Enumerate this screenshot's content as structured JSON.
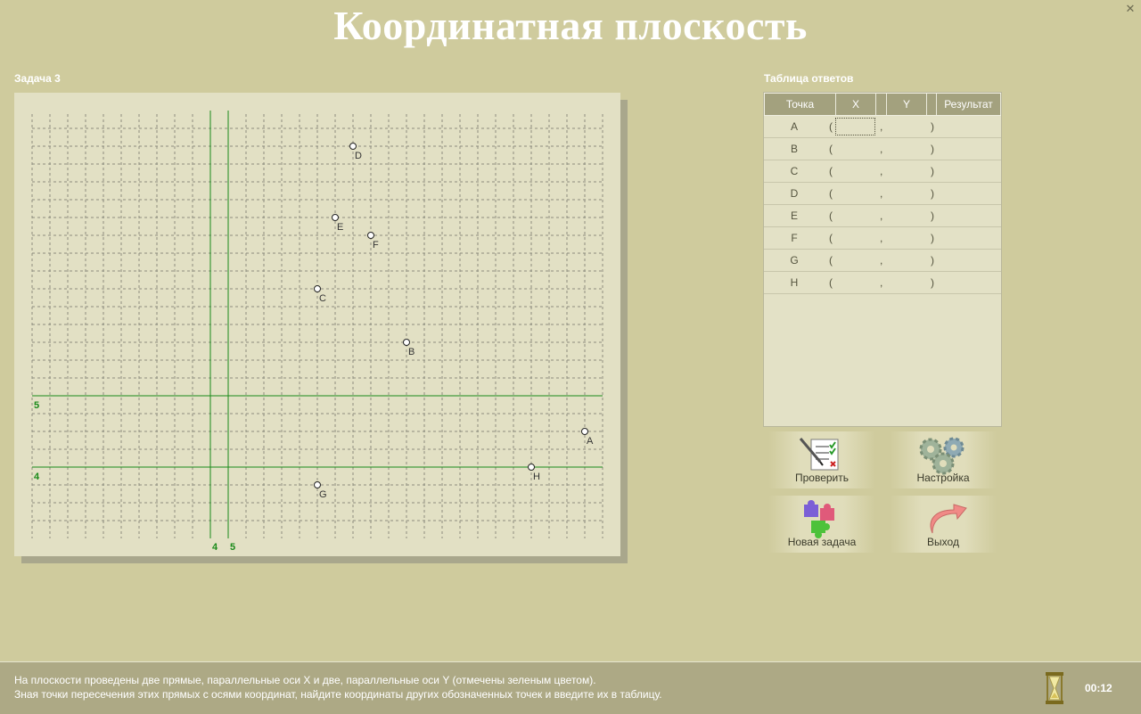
{
  "window": {
    "title": "Координатная плоскость",
    "close_icon": "close-icon",
    "close_glyph": "✕"
  },
  "task": {
    "label": "Задача 3"
  },
  "plot": {
    "axis_labels": {
      "x_line_4": "4",
      "x_line_5": "5",
      "y_line_4": "4",
      "y_line_5": "5"
    },
    "points": [
      {
        "name": "A"
      },
      {
        "name": "B"
      },
      {
        "name": "C"
      },
      {
        "name": "D"
      },
      {
        "name": "E"
      },
      {
        "name": "F"
      },
      {
        "name": "G"
      },
      {
        "name": "H"
      }
    ],
    "colors": {
      "green_lines": "#1a8a1a",
      "grid": "#8d8d7e",
      "panel": "#e2e0c4"
    }
  },
  "answers": {
    "label": "Таблица ответов",
    "columns": [
      "Точка",
      "X",
      "Y",
      "Результат"
    ],
    "rows": [
      {
        "point": "A",
        "open": "(",
        "comma": ",",
        "close": ")",
        "x": "",
        "y": ""
      },
      {
        "point": "B",
        "open": "(",
        "comma": ",",
        "close": ")",
        "x": "",
        "y": ""
      },
      {
        "point": "C",
        "open": "(",
        "comma": ",",
        "close": ")",
        "x": "",
        "y": ""
      },
      {
        "point": "D",
        "open": "(",
        "comma": ",",
        "close": ")",
        "x": "",
        "y": ""
      },
      {
        "point": "E",
        "open": "(",
        "comma": ",",
        "close": ")",
        "x": "",
        "y": ""
      },
      {
        "point": "F",
        "open": "(",
        "comma": ",",
        "close": ")",
        "x": "",
        "y": ""
      },
      {
        "point": "G",
        "open": "(",
        "comma": ",",
        "close": ")",
        "x": "",
        "y": ""
      },
      {
        "point": "H",
        "open": "(",
        "comma": ",",
        "close": ")",
        "x": "",
        "y": ""
      }
    ]
  },
  "buttons": {
    "check": {
      "label": "Проверить",
      "icon": "checklist-icon"
    },
    "settings": {
      "label": "Настройка",
      "icon": "gears-icon"
    },
    "new_task": {
      "label": "Новая задача",
      "icon": "puzzle-icon"
    },
    "exit": {
      "label": "Выход",
      "icon": "arrow-back-icon"
    }
  },
  "footer": {
    "line1": "На плоскости проведены две прямые, параллельные оси X и две, параллельные оси Y (отмечены зеленым цветом).",
    "line2": "Зная точки пересечения этих прямых с осями координат, найдите координаты других обозначенных точек и введите их в таблицу.",
    "timer": "00:12",
    "timer_icon": "hourglass-icon"
  }
}
